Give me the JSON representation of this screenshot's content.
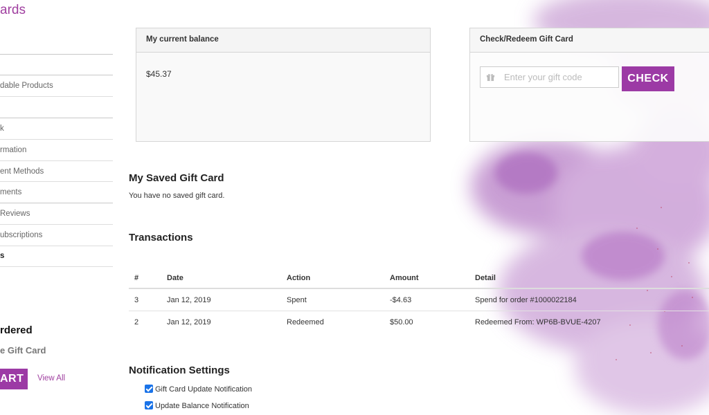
{
  "sidebar": {
    "brand": "ards",
    "items": [
      {
        "label": "dable Products"
      },
      {
        "label": "k"
      },
      {
        "label": "rmation"
      },
      {
        "label": "ent Methods"
      },
      {
        "label": "ments"
      },
      {
        "label": "Reviews"
      },
      {
        "label": "ubscriptions"
      },
      {
        "label": "s"
      }
    ],
    "recommended_title": "rdered",
    "recommended_product": "e Gift Card",
    "cart_button": "ART",
    "view_all": "View All"
  },
  "balance": {
    "title": "My current balance",
    "value": "$45.37"
  },
  "redeem": {
    "title": "Check/Redeem Gift Card",
    "placeholder": "Enter your gift code",
    "button": "CHECK",
    "icon": "gift-icon"
  },
  "saved": {
    "title": "My Saved Gift Card",
    "empty_text": "You have no saved gift card."
  },
  "transactions": {
    "title": "Transactions",
    "columns": [
      "#",
      "Date",
      "Action",
      "Amount",
      "Detail"
    ],
    "rows": [
      [
        "3",
        "Jan 12, 2019",
        "Spent",
        "-$4.63",
        "Spend for order #1000022184"
      ],
      [
        "2",
        "Jan 12, 2019",
        "Redeemed",
        "$50.00",
        "Redeemed From: WP6B-BVUE-4207"
      ]
    ]
  },
  "notifications": {
    "title": "Notification Settings",
    "options": [
      {
        "label": "Gift Card Update Notification",
        "checked": true
      },
      {
        "label": "Update Balance Notification",
        "checked": true
      }
    ]
  },
  "colors": {
    "accent": "#9c3aa5",
    "link": "#a040a0",
    "checkbox": "#1a73e8"
  }
}
